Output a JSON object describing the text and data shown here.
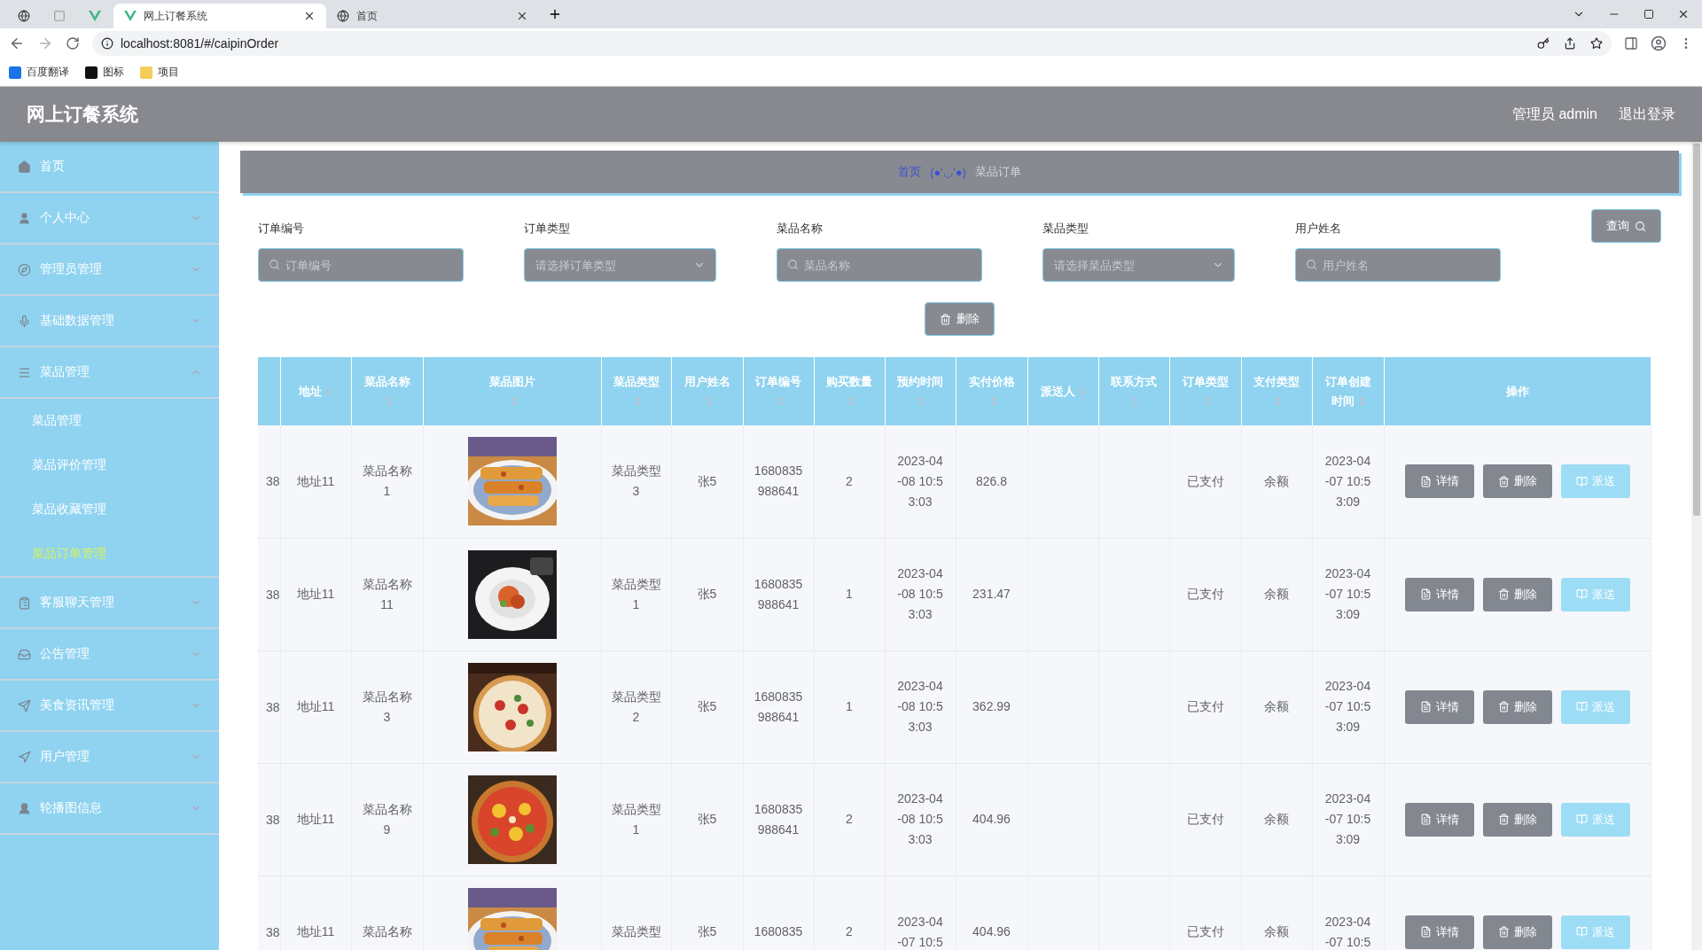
{
  "browser": {
    "tabs": [
      {
        "kind": "pinned",
        "selected": false
      },
      {
        "kind": "pinned",
        "selected": false
      },
      {
        "kind": "pinned",
        "selected": false
      },
      {
        "kind": "page",
        "title": "网上订餐系统",
        "selected": true
      },
      {
        "kind": "page",
        "title": "首页",
        "selected": false
      }
    ],
    "address": "localhost:8081/#/caipinOrder",
    "bookmarks": [
      "百度翻译",
      "图标",
      "项目"
    ]
  },
  "app": {
    "title": "网上订餐系统",
    "user": "管理员 admin",
    "logout": "退出登录"
  },
  "sidebar": {
    "items": [
      {
        "label": "首页",
        "kind": "link"
      },
      {
        "label": "个人中心",
        "kind": "group",
        "expanded": false
      },
      {
        "label": "管理员管理",
        "kind": "group",
        "expanded": false
      },
      {
        "label": "基础数据管理",
        "kind": "group",
        "expanded": false
      },
      {
        "label": "菜品管理",
        "kind": "group",
        "expanded": true,
        "children": [
          {
            "label": "菜品管理",
            "selected": false
          },
          {
            "label": "菜品评价管理",
            "selected": false
          },
          {
            "label": "菜品收藏管理",
            "selected": false
          },
          {
            "label": "菜品订单管理",
            "selected": true
          }
        ]
      },
      {
        "label": "客服聊天管理",
        "kind": "group",
        "expanded": false
      },
      {
        "label": "公告管理",
        "kind": "group",
        "expanded": false
      },
      {
        "label": "美食资讯管理",
        "kind": "group",
        "expanded": false
      },
      {
        "label": "用户管理",
        "kind": "group",
        "expanded": false
      },
      {
        "label": "轮播图信息",
        "kind": "group",
        "expanded": false
      }
    ]
  },
  "breadcrumb": {
    "home": "首页",
    "separator": "(●'◡'●)",
    "current": "菜品订单"
  },
  "search": {
    "fields": [
      {
        "label": "订单编号",
        "placeholder": "订单编号",
        "kind": "text"
      },
      {
        "label": "订单类型",
        "placeholder": "请选择订单类型",
        "kind": "select"
      },
      {
        "label": "菜品名称",
        "placeholder": "菜品名称",
        "kind": "text"
      },
      {
        "label": "菜品类型",
        "placeholder": "请选择菜品类型",
        "kind": "select"
      },
      {
        "label": "用户姓名",
        "placeholder": "用户姓名",
        "kind": "text"
      }
    ],
    "query_button": "查询",
    "delete_button": "删除"
  },
  "table": {
    "columns": [
      {
        "label": "地址",
        "sortable": true
      },
      {
        "label": "菜品名称",
        "sortable": true
      },
      {
        "label": "菜品图片",
        "sortable": true
      },
      {
        "label": "菜品类型",
        "sortable": true
      },
      {
        "label": "用户姓名",
        "sortable": true
      },
      {
        "label": "订单编号",
        "sortable": true
      },
      {
        "label": "购买数量",
        "sortable": true
      },
      {
        "label": "预约时间",
        "sortable": true
      },
      {
        "label": "实付价格",
        "sortable": true
      },
      {
        "label": "派送人",
        "sortable": true
      },
      {
        "label": "联系方式",
        "sortable": true
      },
      {
        "label": "订单类型",
        "sortable": true
      },
      {
        "label": "支付类型",
        "sortable": true
      },
      {
        "label": "订单创建时间",
        "sortable": true
      },
      {
        "label": "操作",
        "sortable": false
      }
    ],
    "rows": [
      {
        "column_0": "38",
        "address": "地址11",
        "dish_name": "菜品名称1",
        "dish_type": "菜品类型3",
        "user_name": "张5",
        "order_no": "1680835988641",
        "quantity": "2",
        "booking_time": "2023-04-08 10:53:03",
        "paid_price": "826.8",
        "order_type": "已支付",
        "pay_type": "余额",
        "created_time": "2023-04-07 10:53:09",
        "actions": [
          {
            "label": "详情",
            "kind": "detail"
          },
          {
            "label": "删除",
            "kind": "delete"
          },
          {
            "label": "派送",
            "kind": "dispatch"
          }
        ]
      },
      {
        "column_0": "38",
        "address": "地址11",
        "dish_name": "菜品名称11",
        "dish_type": "菜品类型1",
        "user_name": "张5",
        "order_no": "1680835988641",
        "quantity": "1",
        "booking_time": "2023-04-08 10:53:03",
        "paid_price": "231.47",
        "order_type": "已支付",
        "pay_type": "余额",
        "created_time": "2023-04-07 10:53:09",
        "actions": [
          {
            "label": "详情",
            "kind": "detail"
          },
          {
            "label": "删除",
            "kind": "delete"
          },
          {
            "label": "派送",
            "kind": "dispatch"
          }
        ]
      },
      {
        "column_0": "38",
        "address": "地址11",
        "dish_name": "菜品名称3",
        "dish_type": "菜品类型2",
        "user_name": "张5",
        "order_no": "1680835988641",
        "quantity": "1",
        "booking_time": "2023-04-08 10:53:03",
        "paid_price": "362.99",
        "order_type": "已支付",
        "pay_type": "余额",
        "created_time": "2023-04-07 10:53:09",
        "actions": [
          {
            "label": "详情",
            "kind": "detail"
          },
          {
            "label": "删除",
            "kind": "delete"
          },
          {
            "label": "派送",
            "kind": "dispatch"
          }
        ]
      },
      {
        "column_0": "38",
        "address": "地址11",
        "dish_name": "菜品名称9",
        "dish_type": "菜品类型1",
        "user_name": "张5",
        "order_no": "1680835988641",
        "quantity": "2",
        "booking_time": "2023-04-08 10:53:03",
        "paid_price": "404.96",
        "order_type": "已支付",
        "pay_type": "余额",
        "created_time": "2023-04-07 10:53:09",
        "actions": [
          {
            "label": "详情",
            "kind": "detail"
          },
          {
            "label": "删除",
            "kind": "delete"
          },
          {
            "label": "派送",
            "kind": "dispatch"
          }
        ]
      },
      {
        "column_0": "38",
        "address": "地址11",
        "dish_name": "菜品名称",
        "dish_type": "菜品类型",
        "user_name": "张5",
        "order_no": "1680835",
        "quantity": "2",
        "booking_time": "2023-04-07 10:5",
        "paid_price": "404.96",
        "order_type": "已支付",
        "pay_type": "余额",
        "created_time": "2023-04-07 10:5",
        "actions": [
          {
            "label": "详情",
            "kind": "detail"
          },
          {
            "label": "删除",
            "kind": "delete"
          },
          {
            "label": "派送",
            "kind": "dispatch"
          }
        ]
      }
    ]
  }
}
